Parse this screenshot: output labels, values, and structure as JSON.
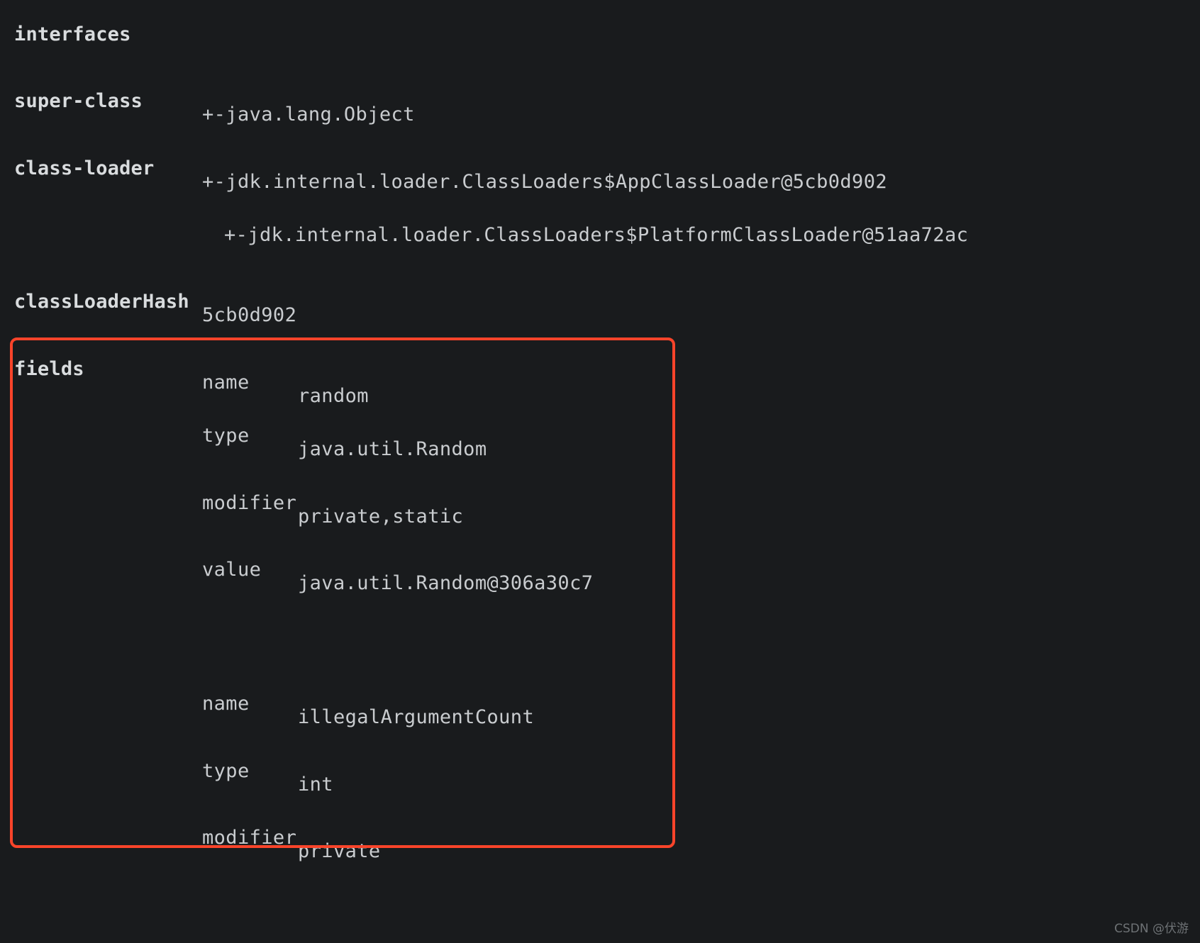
{
  "terminal": {
    "background_color": "#191b1d",
    "text_color": "#c9cccf",
    "rows": [
      {
        "key": "interfaces",
        "subkey": "",
        "value": ""
      },
      {
        "key": "super-class",
        "subkey": "",
        "value": "+-java.lang.Object"
      },
      {
        "key": "class-loader",
        "subkey": "",
        "value": "+-jdk.internal.loader.ClassLoaders$AppClassLoader@5cb0d902"
      },
      {
        "key": "",
        "subkey": "",
        "value": "+-jdk.internal.loader.ClassLoaders$PlatformClassLoader@51aa72ac"
      },
      {
        "key": "classLoaderHash",
        "subkey": "",
        "value": "5cb0d902"
      }
    ],
    "fields_label": "fields",
    "fields": [
      {
        "name_key": "name",
        "name_value": "random",
        "type_key": "type",
        "type_value": "java.util.Random",
        "modifier_key": "modifier",
        "modifier_value": "private,static",
        "value_key": "value",
        "value_value": "java.util.Random@306a30c7"
      },
      {
        "name_key": "name",
        "name_value": "illegalArgumentCount",
        "type_key": "type",
        "type_value": "int",
        "modifier_key": "modifier",
        "modifier_value": "private"
      }
    ]
  },
  "annotation": {
    "color": "#f9442a",
    "target": "fields"
  },
  "watermark": {
    "text": "CSDN @伏游"
  }
}
